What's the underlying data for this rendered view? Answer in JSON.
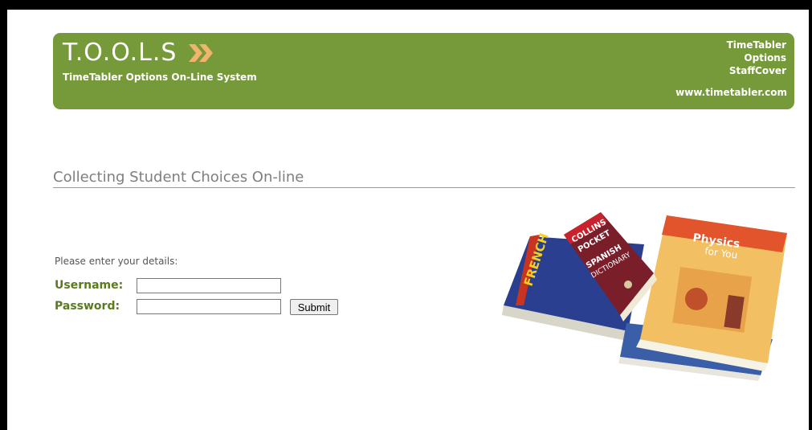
{
  "header": {
    "logo": "T.O.O.L.S",
    "tagline": "TimeTabler Options On-Line System",
    "links": [
      "TimeTabler",
      "Options",
      "StaffCover"
    ],
    "url": "www.timetabler.com"
  },
  "main": {
    "heading": "Collecting Student Choices On-line",
    "prompt": "Please enter your details:",
    "username_label": "Username:",
    "password_label": "Password:",
    "username_value": "",
    "password_value": "",
    "submit_label": "Submit"
  },
  "image": {
    "books": [
      "FRENCH",
      "COLLINS POCKET SPANISH DICTIONARY",
      "Physics for You"
    ]
  },
  "colors": {
    "banner": "#769a3a",
    "label": "#5b7a1f",
    "chevron": "#f0b46c"
  },
  "icons": {
    "logo_chevron": "double-chevron-right-icon"
  }
}
